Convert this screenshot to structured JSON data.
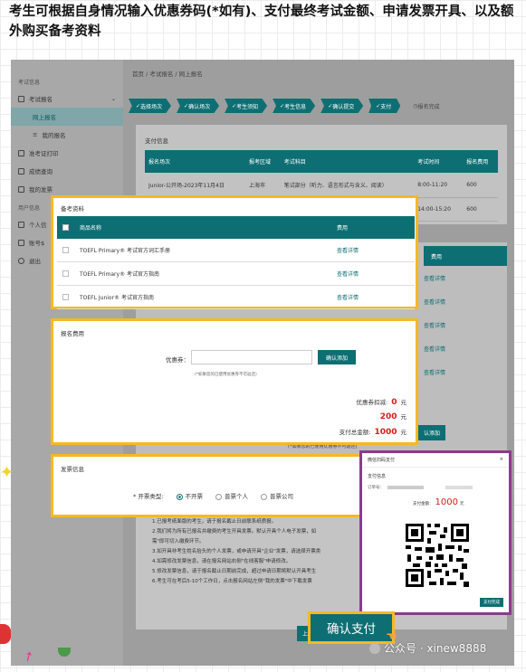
{
  "header_text": "考生可根据自身情况输入优惠券码(*如有)、支付最终考试金额、申请发票开具、以及额外购买备考资料",
  "sidebar": {
    "section1": "考试信息",
    "items": [
      {
        "label": "考试报名",
        "type": "group"
      },
      {
        "label": "网上报名",
        "type": "sub-selected"
      },
      {
        "label": "我的报名",
        "type": "sub"
      },
      {
        "label": "准考证打印",
        "type": "item"
      },
      {
        "label": "成绩查询",
        "type": "item"
      },
      {
        "label": "我的发票",
        "type": "item"
      }
    ],
    "section2": "用户信息",
    "items2": [
      {
        "label": "个人信"
      },
      {
        "label": "账号$"
      },
      {
        "label": "退出"
      }
    ]
  },
  "breadcrumb": "首页 / 考试报名 / 网上报名",
  "steps": [
    "选择场次",
    "确认场次",
    "考生须知",
    "考生信息",
    "确认提交",
    "支付",
    "报名完成"
  ],
  "payment_panel": {
    "title": "支付信息",
    "headers": [
      "报名场次",
      "报考区域",
      "考试科目",
      "考试时间",
      "报名费用"
    ],
    "rows": [
      [
        "Junior-公开场-2023年11月4日",
        "上海市",
        "笔试部分（听力、语言形式与含义、阅读）",
        "8:00-11:20",
        "600"
      ],
      [
        "",
        "",
        "",
        "14:00-15:20",
        "600"
      ]
    ]
  },
  "bg_fee_header": "费用",
  "bg_links": [
    "查看详情",
    "查看详情",
    "查看详情",
    "查看详情",
    "查看详情"
  ],
  "bg_add_button": "认添加",
  "bg_coupon_hint": "(*如果您的已使用优惠券不可退还)",
  "bg_info_lines": [
    "1.已报考纸面版的考生，请于报名截止日前联系纸质报。",
    "2.我们将为所有已报名并缴费的考生开具发票。默认开具个人电子发票，如",
    "  需\"即可切入缴费环节。",
    "3.如开具非考生姓名抬头的个人发票，或申请开具\"企业\"发票，请选择开票类",
    "4.如需修改发票信息，请在报名网站右侧\"在线客服\"申请修改。",
    "5.修改发票信息，请于报名截止日期前完成，超过申请日期将默认开具考生",
    "6.考生可在考后5-10个工作日，点击报名网站左侧\"我的发票\"中下载发票"
  ],
  "bg_prev_button": "上一",
  "materials": {
    "title": "备考资料",
    "col_name": "商品名称",
    "col_fee": "费用",
    "items": [
      {
        "name": "TOEFL Primary® 考试官方词汇手册",
        "link": "查看详情"
      },
      {
        "name": "TOEFL Primary® 考试官方指南",
        "link": "查看详情"
      },
      {
        "name": "TOEFL Junior® 考试官方指南",
        "link": "查看详情"
      }
    ]
  },
  "fee": {
    "title": "报名费用",
    "coupon_label": "优惠券：",
    "coupon_placeholder": "",
    "confirm_add": "确认添加",
    "hint": "(*如果您的已使用优惠券不可返还)",
    "coupon_deduct_label": "优惠券扣减:",
    "coupon_deduct_value": "0",
    "unit": "元",
    "subtotal": "200",
    "total_label": "支付总金额:",
    "total_value": "1000"
  },
  "invoice": {
    "title": "发票信息",
    "type_label": "* 开票类型:",
    "options": [
      "不开票",
      "普票个人",
      "普票公司"
    ]
  },
  "qr_modal": {
    "title": "微信扫码支付",
    "close": "×",
    "section": "支付信息",
    "order_label": "订单号：",
    "amount_label": "支付金额：",
    "amount": "1000",
    "unit": "元",
    "done_button": "支付完成"
  },
  "confirm_pay_button": "确认支付",
  "watermark": "公众号 · xinew8888",
  "colors": {
    "accent": "#0d6f73",
    "highlight": "#f5b921",
    "modal_border": "#8b3a8f",
    "price_red": "#d0201a"
  }
}
